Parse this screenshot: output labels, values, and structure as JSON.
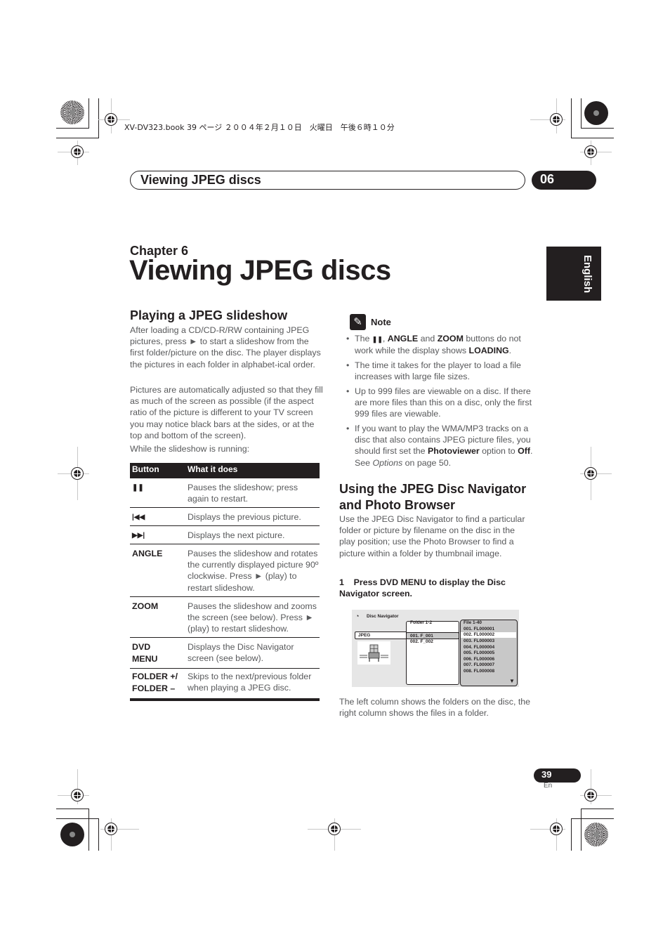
{
  "print_header": "XV-DV323.book  39 ページ  ２００４年２月１０日　火曜日　午後６時１０分",
  "section_header": {
    "title": "Viewing JPEG discs",
    "chapter_number": "06"
  },
  "chapter": {
    "label": "Chapter 6",
    "title": "Viewing JPEG discs"
  },
  "language_tab": "English",
  "left_column": {
    "heading": "Playing a JPEG slideshow",
    "para1": "After loading a CD/CD-R/RW containing JPEG pictures, press ► to start a slideshow from the first folder/picture on the disc. The player displays the pictures in each folder in alphabet-ical order.",
    "para2": "Pictures are automatically adjusted so that they fill as much of the screen as possible (if the aspect ratio of the picture is different to your TV screen you may notice black bars at the sides, or at the top and bottom of the screen).",
    "para3": "While the slideshow is running:",
    "table": {
      "headers": [
        "Button",
        "What it does"
      ],
      "rows": [
        {
          "button": "❚❚",
          "desc": "Pauses the slideshow; press again to restart."
        },
        {
          "button": "|◀◀",
          "desc": "Displays the previous picture."
        },
        {
          "button": "▶▶|",
          "desc": "Displays the next picture."
        },
        {
          "button": "ANGLE",
          "desc": "Pauses the slideshow and rotates the currently displayed picture 90º clockwise. Press ► (play) to restart slideshow."
        },
        {
          "button": "ZOOM",
          "desc": "Pauses the slideshow and zooms the screen (see below). Press ► (play) to restart slideshow."
        },
        {
          "button": "DVD MENU",
          "desc": "Displays the Disc Navigator screen (see below)."
        },
        {
          "button": "FOLDER +/ FOLDER –",
          "desc": "Skips to the next/previous folder when playing a JPEG disc."
        }
      ]
    }
  },
  "note": {
    "title": "Note",
    "items": [
      {
        "pre": "The ",
        "b1": "❚❚",
        "m1": ", ",
        "b2": "ANGLE",
        "m2": " and ",
        "b3": "ZOOM",
        "m3": " buttons do not work while the display shows ",
        "b4": "LOADING",
        "post": "."
      },
      {
        "text": "The time it takes for the player to load a file increases with large file sizes."
      },
      {
        "text": "Up to 999 files are viewable on a disc. If there are more files than this on a disc, only the first 999 files are viewable."
      },
      {
        "pre": "If you want to play the WMA/MP3 tracks on a disc that also contains JPEG picture files, you should first set the ",
        "b1": "Photoviewer",
        "m1": " option to ",
        "b2": "Off",
        "m2": ". See ",
        "i1": "Options",
        "post": " on page 50."
      }
    ]
  },
  "right_column": {
    "heading": "Using the JPEG Disc Navigator and Photo Browser",
    "para1": "Use the JPEG Disc Navigator to find a particular folder or picture by filename on the disc in the play position; use the Photo Browser to find a picture within a folder by thumbnail image.",
    "step1": "1    Press DVD MENU to display the Disc Navigator screen.",
    "caption": "The left column shows the folders on the disc, the right column shows the files in a folder."
  },
  "disc_navigator": {
    "title": "Disc Navigator",
    "tab": "JPEG",
    "folder_header": "Folder 1-2",
    "folders": [
      "001. F_001",
      "002. F_002"
    ],
    "selected_folder": 0,
    "file_header": "File 1-40",
    "files": [
      "001. FL000001",
      "002. FL000002",
      "003. FL000003",
      "004. FL000004",
      "005. FL000005",
      "006. FL000006",
      "007. FL000007",
      "008. FL000008"
    ],
    "selected_file": 1
  },
  "footer": {
    "page_number": "39",
    "language": "En"
  }
}
